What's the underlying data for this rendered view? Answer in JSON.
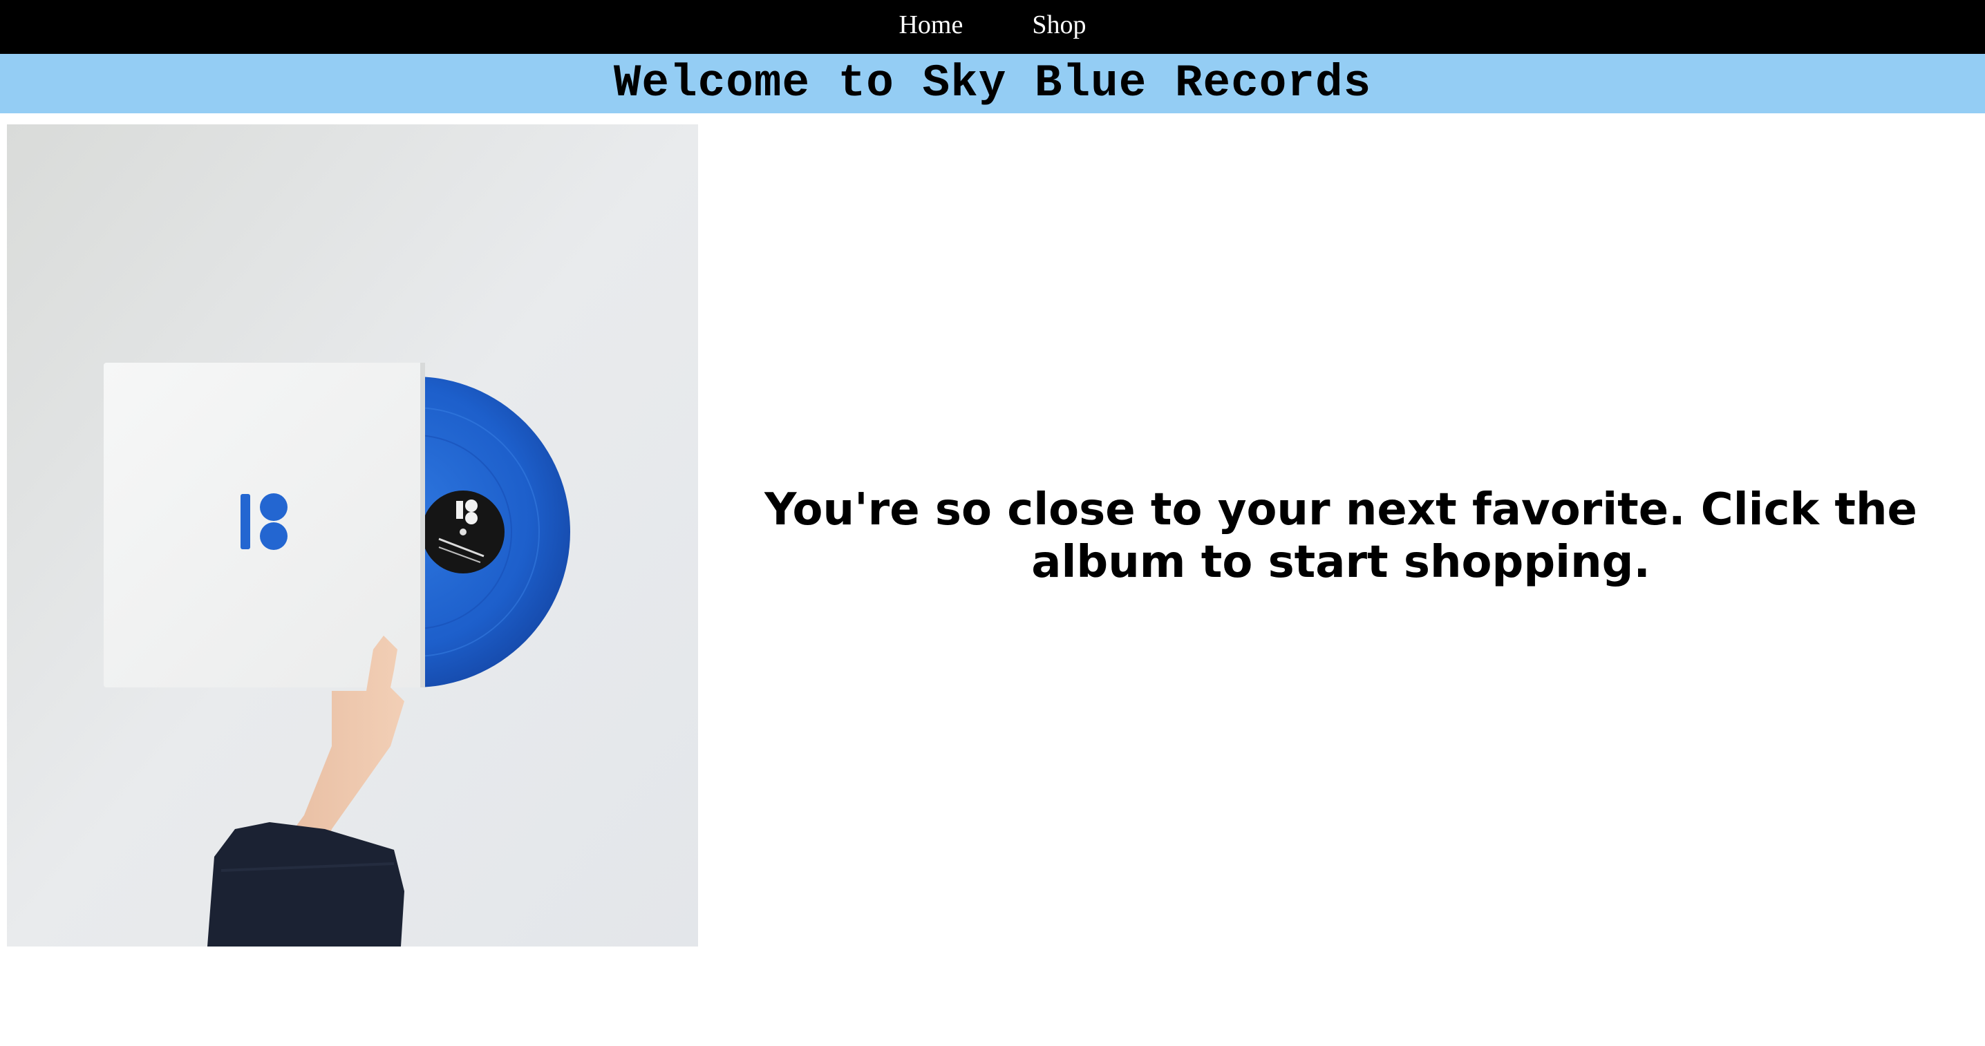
{
  "nav": {
    "items": [
      {
        "label": "Home"
      },
      {
        "label": "Shop"
      }
    ]
  },
  "banner": {
    "title": "Welcome to Sky Blue Records"
  },
  "main": {
    "promo_text": "You're so close to your next favorite. Click the album to start shopping.",
    "album_image": {
      "icon": "vinyl-album-photo",
      "description_colors": {
        "record": "#1f5fc4",
        "sleeve": "#f4f5f5",
        "background": "#e6e8ea"
      }
    }
  },
  "colors": {
    "navbar": "#000000",
    "banner": "#94cdf4",
    "nav_text": "#ffffff"
  }
}
